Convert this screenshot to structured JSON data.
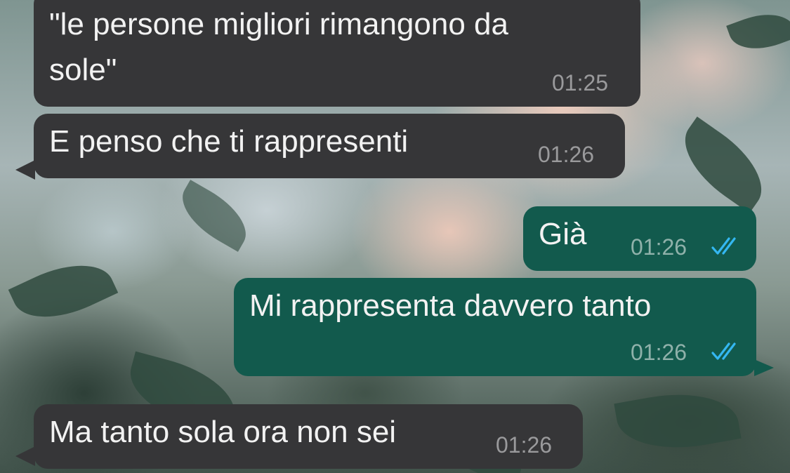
{
  "messages": [
    {
      "direction": "in",
      "text_line1": "\"le persone migliori rimangono da",
      "text_line2": "sole\"",
      "time": "01:25"
    },
    {
      "direction": "in",
      "text": "E penso che ti rappresenti",
      "time": "01:26"
    },
    {
      "direction": "out",
      "text": "Già",
      "time": "01:26",
      "status": "read",
      "status_icon": "double-check-icon"
    },
    {
      "direction": "out",
      "text": "Mi rappresenta davvero tanto",
      "time": "01:26",
      "status": "read",
      "status_icon": "double-check-icon"
    },
    {
      "direction": "in",
      "text": "Ma tanto sola ora non sei",
      "time": "01:26"
    }
  ],
  "colors": {
    "incoming_bubble": "#363638",
    "outgoing_bubble": "#125a4d",
    "read_ticks": "#34b7f1",
    "time_text": "#9a9a9c"
  }
}
